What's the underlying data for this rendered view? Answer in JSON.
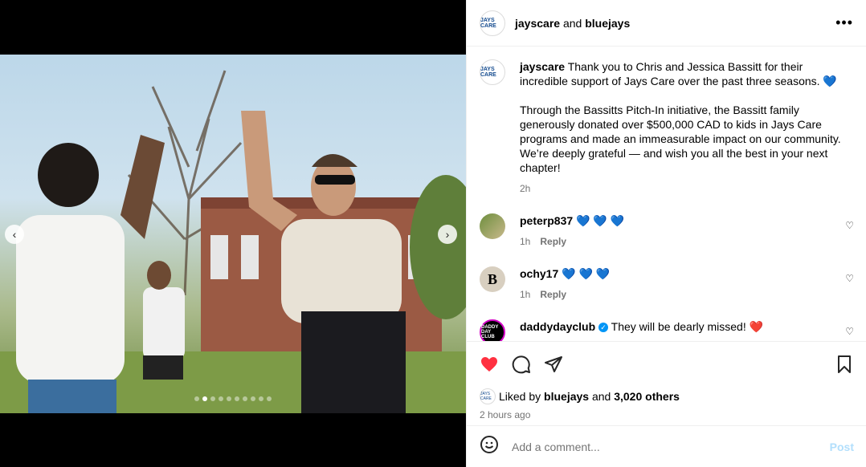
{
  "header": {
    "account": "jayscare",
    "joiner": "and",
    "collaborator": "bluejays",
    "more_icon": "more-horizontal-icon"
  },
  "caption": {
    "username": "jayscare",
    "text1": "Thank you to Chris and Jessica Bassitt for their incredible support of Jays Care over the past three seasons. 💙",
    "text2": "Through the Bassitts Pitch-In initiative, the Bassitt family generously donated over $500,000 CAD to kids in Jays Care programs and made an immeasurable impact on our community. We’re deeply grateful — and wish you all the best in your next chapter!",
    "time": "2h"
  },
  "comments": [
    {
      "username": "peterp837",
      "text": "💙 💙 💙",
      "time": "1h",
      "reply": "Reply"
    },
    {
      "username": "ochy17",
      "text": "💙 💙 💙",
      "time": "1h",
      "reply": "Reply"
    },
    {
      "username": "daddydayclub",
      "text": "They will be dearly missed! ❤️",
      "verified": true
    }
  ],
  "avatar_text": {
    "jays": "JAYS CARE",
    "ochy": "B",
    "daddy": "DADDY DAY CLUB"
  },
  "likes": {
    "prefix": "Liked by",
    "user": "bluejays",
    "and": "and",
    "count": "3,020 others"
  },
  "post_time": "2 hours ago",
  "comment_box": {
    "placeholder": "Add a comment...",
    "post": "Post"
  },
  "carousel": {
    "count": 10,
    "active": 1
  },
  "colors": {
    "like": "#ff3040",
    "link": "#0095f6",
    "post_disabled": "#b2dffc"
  }
}
